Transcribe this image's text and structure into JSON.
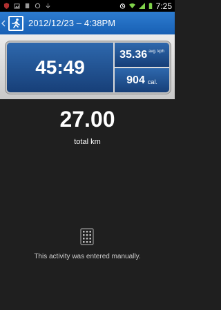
{
  "status_bar": {
    "time": "7:25"
  },
  "action_bar": {
    "title": "2012/12/23 – 4:38PM"
  },
  "summary": {
    "duration": "45:49",
    "avg_speed": {
      "value": "35.36",
      "unit": "avg. kph"
    },
    "calories": {
      "value": "904",
      "unit": "cal."
    }
  },
  "distance": {
    "value": "27.00",
    "label": "total km"
  },
  "manual_message": "This activity was entered manually.",
  "colors": {
    "accent": "#1f6fc6",
    "panel": "#1d4f8c",
    "background": "#1f1f1f"
  },
  "icons": [
    "running-app-icon",
    "keypad-icon"
  ]
}
